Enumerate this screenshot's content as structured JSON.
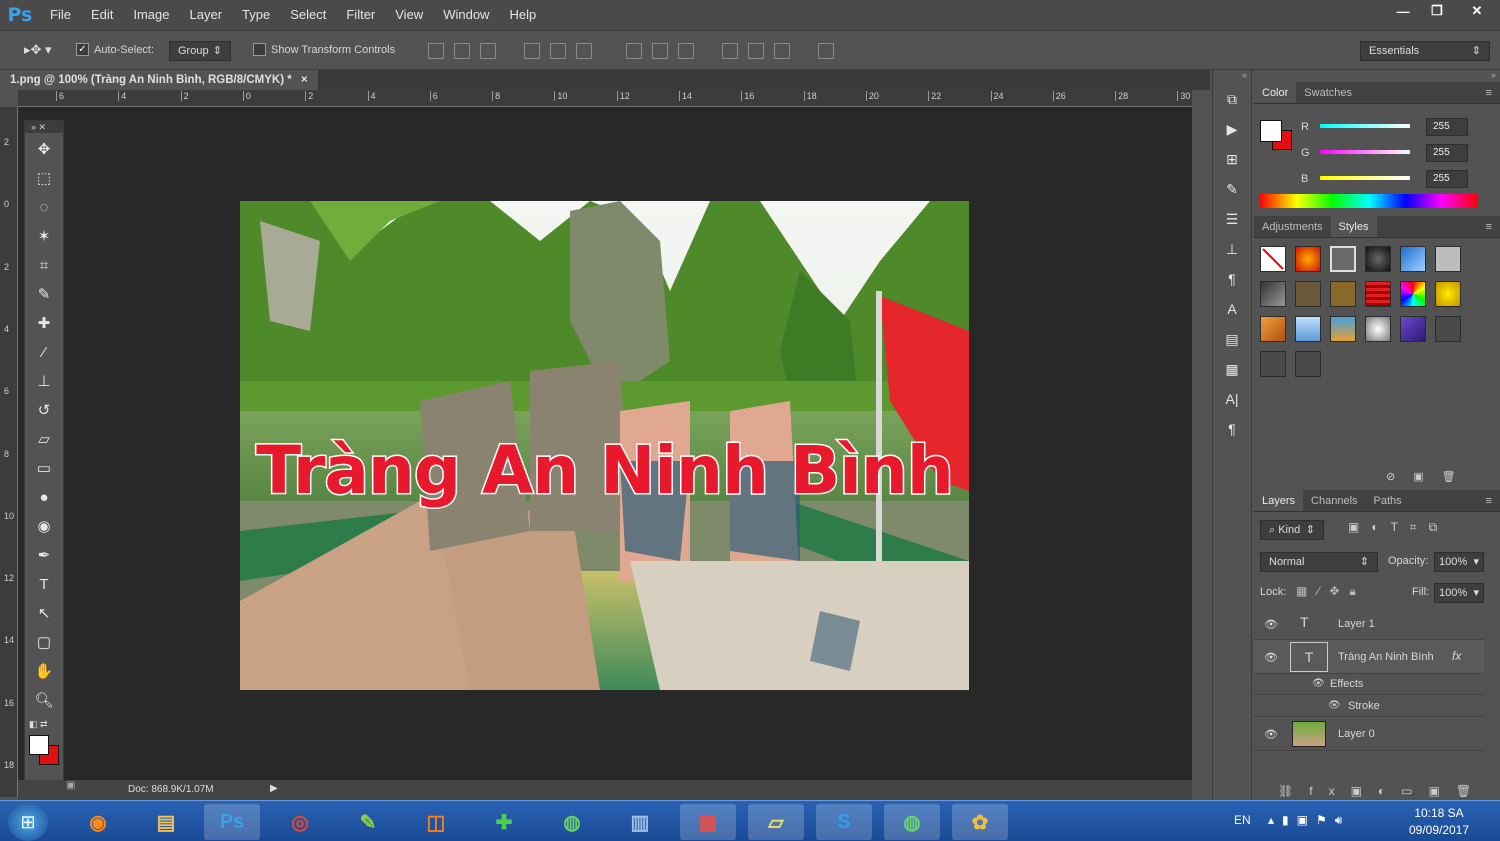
{
  "app": {
    "logo": "Ps"
  },
  "menu": [
    "File",
    "Edit",
    "Image",
    "Layer",
    "Type",
    "Select",
    "Filter",
    "View",
    "Window",
    "Help"
  ],
  "window_controls": {
    "minimize": "—",
    "restore": "❐",
    "close": "✕"
  },
  "options": {
    "auto_select_label": "Auto-Select:",
    "auto_select_checked": true,
    "auto_select_value": "Group",
    "show_transform_label": "Show Transform Controls",
    "show_transform_checked": false,
    "workspace": "Essentials"
  },
  "document": {
    "tab_title": "1.png @ 100% (Tràng An Ninh Bình, RGB/8/CMYK) *",
    "tab_close": "×",
    "doc_size": "Doc: 868.9K/1.07M",
    "canvas_text": "Tràng An Ninh Bình"
  },
  "ruler": {
    "h_labels": [
      "6",
      "4",
      "2",
      "0",
      "2",
      "4",
      "6",
      "8",
      "10",
      "12",
      "14",
      "16",
      "18",
      "20",
      "22",
      "24",
      "26",
      "28",
      "30"
    ],
    "v_labels": [
      "2",
      "0",
      "2",
      "4",
      "6",
      "8",
      "10",
      "12",
      "14",
      "16",
      "18"
    ]
  },
  "tools": [
    "move-tool",
    "marquee-tool",
    "lasso-tool",
    "magic-wand-tool",
    "crop-tool",
    "eyedropper-tool",
    "healing-tool",
    "brush-tool",
    "stamp-tool",
    "history-brush-tool",
    "eraser-tool",
    "gradient-tool",
    "blur-tool",
    "dodge-tool",
    "pen-tool",
    "type-tool",
    "path-select-tool",
    "shape-tool",
    "hand-tool",
    "zoom-tool"
  ],
  "color_panel": {
    "tabs": [
      "Color",
      "Swatches"
    ],
    "active_tab": "Color",
    "channels": [
      {
        "label": "R",
        "value": "255"
      },
      {
        "label": "G",
        "value": "255"
      },
      {
        "label": "B",
        "value": "255"
      }
    ],
    "foreground": "#ffffff",
    "background": "#e01010"
  },
  "styles_panel": {
    "tabs": [
      "Adjustments",
      "Styles"
    ],
    "active_tab": "Styles"
  },
  "layers_panel": {
    "tabs": [
      "Layers",
      "Channels",
      "Paths"
    ],
    "active_tab": "Layers",
    "filter": "Kind",
    "blend_mode": "Normal",
    "opacity_label": "Opacity:",
    "opacity": "100%",
    "lock_label": "Lock:",
    "fill_label": "Fill:",
    "fill": "100%",
    "layers": [
      {
        "name": "Layer 1",
        "type": "text"
      },
      {
        "name": "Tràng An Ninh Bình",
        "type": "text",
        "fx": "fx",
        "effects_label": "Effects",
        "effect": "Stroke"
      },
      {
        "name": "Layer 0",
        "type": "image"
      }
    ]
  },
  "taskbar": {
    "lang": "EN",
    "time": "10:18 SA",
    "date": "09/09/2017",
    "apps": [
      "firefox-icon",
      "explorer-icon",
      "photoshop-icon",
      "chrome-icon",
      "notepad-icon",
      "outlook-icon",
      "add-icon",
      "coccoc-icon",
      "network-icon",
      "app-icon",
      "folder-icon",
      "skype-icon",
      "coccoc-icon-2",
      "paint-icon"
    ]
  },
  "colors": {
    "accent": "#3ba0e6",
    "canvas_text": "#e8192c",
    "stroke": "#ffffff"
  }
}
